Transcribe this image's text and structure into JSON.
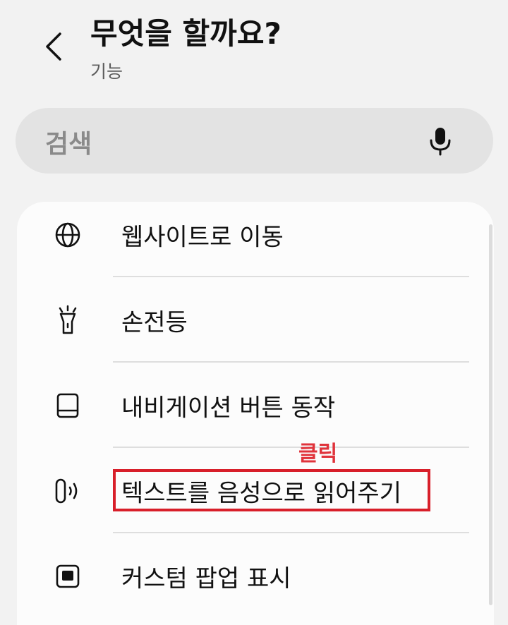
{
  "header": {
    "title": "무엇을 할까요?",
    "subtitle": "기능",
    "back_icon": "chevron-left-icon"
  },
  "search": {
    "placeholder": "검색",
    "mic_icon": "microphone-icon"
  },
  "items": [
    {
      "label": "웹사이트로 이동",
      "icon": "globe-icon"
    },
    {
      "label": "손전등",
      "icon": "flashlight-icon"
    },
    {
      "label": "내비게이션 버튼 동작",
      "icon": "navigation-bar-icon"
    },
    {
      "label": "텍스트를 음성으로 읽어주기",
      "icon": "text-to-speech-icon"
    },
    {
      "label": "커스텀 팝업 표시",
      "icon": "popup-icon"
    }
  ],
  "annotation": {
    "text": "클릭",
    "color": "#d81f2a"
  }
}
